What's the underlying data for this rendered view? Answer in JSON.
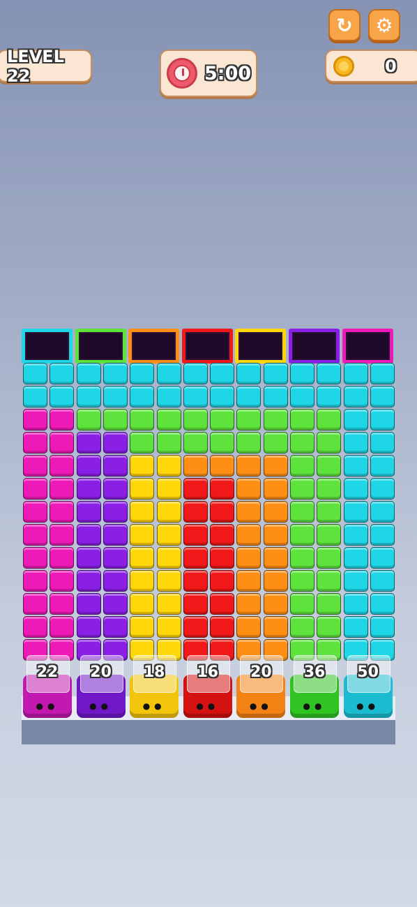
{
  "hud": {
    "level_label": "LEVEL 22",
    "timer": "5:00",
    "coins": "0",
    "restart_icon": "restart-icon",
    "settings_icon": "gear-icon"
  },
  "colors": {
    "cyan": "#1fd6e6",
    "green": "#5ee33c",
    "magenta": "#ee1ab8",
    "purple": "#8a1fe6",
    "yellow": "#ffd60a",
    "orange": "#ff8f14",
    "red": "#f01818"
  },
  "tubes": [
    "cyan",
    "green",
    "orange",
    "red",
    "yellow",
    "purple",
    "magenta"
  ],
  "grid_columns": [
    [
      "cyan",
      "cyan",
      "magenta",
      "magenta",
      "magenta",
      "magenta",
      "magenta",
      "magenta",
      "magenta",
      "magenta",
      "magenta",
      "magenta",
      "magenta"
    ],
    [
      "cyan",
      "cyan",
      "magenta",
      "magenta",
      "magenta",
      "magenta",
      "magenta",
      "magenta",
      "magenta",
      "magenta",
      "magenta",
      "magenta",
      "magenta"
    ],
    [
      "cyan",
      "cyan",
      "green",
      "purple",
      "purple",
      "purple",
      "purple",
      "purple",
      "purple",
      "purple",
      "purple",
      "purple",
      "purple"
    ],
    [
      "cyan",
      "cyan",
      "green",
      "purple",
      "purple",
      "purple",
      "purple",
      "purple",
      "purple",
      "purple",
      "purple",
      "purple",
      "purple"
    ],
    [
      "cyan",
      "cyan",
      "green",
      "green",
      "yellow",
      "yellow",
      "yellow",
      "yellow",
      "yellow",
      "yellow",
      "yellow",
      "yellow",
      "yellow"
    ],
    [
      "cyan",
      "cyan",
      "green",
      "green",
      "yellow",
      "yellow",
      "yellow",
      "yellow",
      "yellow",
      "yellow",
      "yellow",
      "yellow",
      "yellow"
    ],
    [
      "cyan",
      "cyan",
      "green",
      "green",
      "orange",
      "red",
      "red",
      "red",
      "red",
      "red",
      "red",
      "red",
      "red"
    ],
    [
      "cyan",
      "cyan",
      "green",
      "green",
      "orange",
      "red",
      "red",
      "red",
      "red",
      "red",
      "red",
      "red",
      "red"
    ],
    [
      "cyan",
      "cyan",
      "green",
      "green",
      "orange",
      "orange",
      "orange",
      "orange",
      "orange",
      "orange",
      "orange",
      "orange",
      "orange"
    ],
    [
      "cyan",
      "cyan",
      "green",
      "green",
      "orange",
      "orange",
      "orange",
      "orange",
      "orange",
      "orange",
      "orange",
      "orange",
      "orange"
    ],
    [
      "cyan",
      "cyan",
      "green",
      "green",
      "green",
      "green",
      "green",
      "green",
      "green",
      "green",
      "green",
      "green",
      "green"
    ],
    [
      "cyan",
      "cyan",
      "green",
      "green",
      "green",
      "green",
      "green",
      "green",
      "green",
      "green",
      "green",
      "green",
      "green"
    ],
    [
      "cyan",
      "cyan",
      "cyan",
      "cyan",
      "cyan",
      "cyan",
      "cyan",
      "cyan",
      "cyan",
      "cyan",
      "cyan",
      "cyan",
      "cyan"
    ],
    [
      "cyan",
      "cyan",
      "cyan",
      "cyan",
      "cyan",
      "cyan",
      "cyan",
      "cyan",
      "cyan",
      "cyan",
      "cyan",
      "cyan",
      "cyan"
    ]
  ],
  "counters": [
    {
      "value": "22",
      "color": "#c21ab0"
    },
    {
      "value": "20",
      "color": "#7018c8"
    },
    {
      "value": "18",
      "color": "#f2c40a"
    },
    {
      "value": "16",
      "color": "#d41212"
    },
    {
      "value": "20",
      "color": "#f58214"
    },
    {
      "value": "36",
      "color": "#30c423"
    },
    {
      "value": "50",
      "color": "#1cbcd0"
    }
  ]
}
